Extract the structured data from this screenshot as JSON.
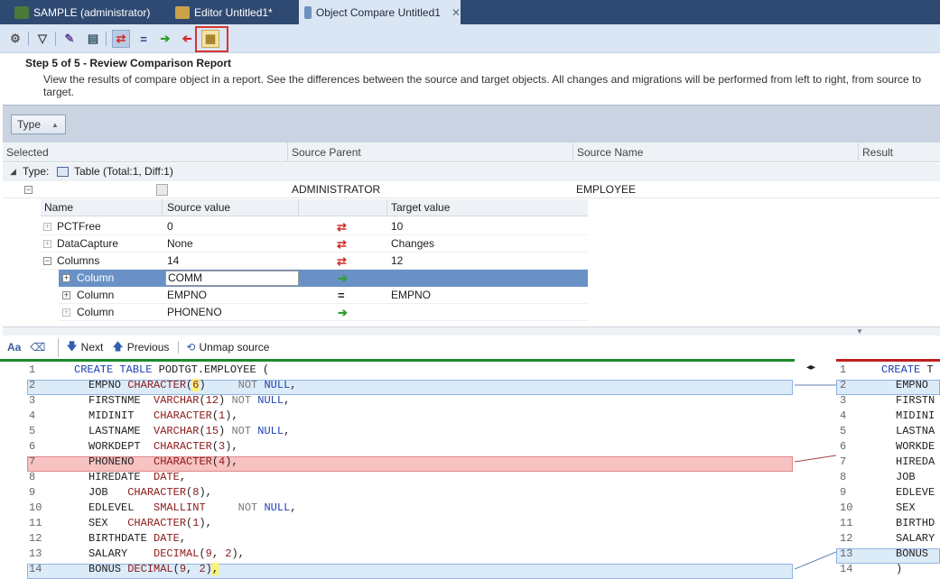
{
  "tabs": [
    {
      "label": "SAMPLE (administrator)"
    },
    {
      "label": "Editor Untitled1*"
    },
    {
      "label": "Object Compare Untitled1"
    }
  ],
  "step": {
    "title": "Step 5 of 5 - Review Comparison Report",
    "description": "View the results of compare object in a report. See the differences between the source and target objects. All changes and migrations will be performed from left to right, from source to target."
  },
  "type_filter": {
    "label": "Type"
  },
  "grid": {
    "headers": [
      "Selected",
      "Source Parent",
      "Source Name",
      "Result"
    ],
    "group_label": "Type:",
    "group_value": "Table (Total:1, Diff:1)",
    "table_row": {
      "source_parent": "ADMINISTRATOR",
      "source_name": "EMPLOYEE"
    },
    "sub_headers": [
      "Name",
      "Source value",
      "Target value"
    ],
    "rows": [
      {
        "name": "PCTFree",
        "source": "0",
        "target": "10",
        "result": "diff"
      },
      {
        "name": "DataCapture",
        "source": "None",
        "target": "Changes",
        "result": "diff"
      },
      {
        "name": "Columns",
        "source": "14",
        "target": "12",
        "result": "diff"
      },
      {
        "name": "Column",
        "source": "COMM",
        "target": "",
        "result": "add"
      },
      {
        "name": "Column",
        "source": "EMPNO",
        "target": "EMPNO",
        "result": "equal"
      },
      {
        "name": "Column",
        "source": "PHONENO",
        "target": "",
        "result": "add"
      }
    ]
  },
  "nav": {
    "next": "Next",
    "previous": "Previous",
    "unmap": "Unmap source"
  },
  "code_left": [
    {
      "n": "1",
      "text": "CREATE TABLE PODTGT.EMPLOYEE ("
    },
    {
      "n": "2",
      "text": "EMPNO CHARACTER(6)     NOT NULL,"
    },
    {
      "n": "3",
      "text": "FIRSTNME  VARCHAR(12) NOT NULL,"
    },
    {
      "n": "4",
      "text": "MIDINIT   CHARACTER(1),"
    },
    {
      "n": "5",
      "text": "LASTNAME  VARCHAR(15) NOT NULL,"
    },
    {
      "n": "6",
      "text": "WORKDEPT  CHARACTER(3),"
    },
    {
      "n": "7",
      "text": "PHONENO   CHARACTER(4),"
    },
    {
      "n": "8",
      "text": "HIREDATE  DATE,"
    },
    {
      "n": "9",
      "text": "JOB   CHARACTER(8),"
    },
    {
      "n": "10",
      "text": "EDLEVEL   SMALLINT     NOT NULL,"
    },
    {
      "n": "11",
      "text": "SEX   CHARACTER(1),"
    },
    {
      "n": "12",
      "text": "BIRTHDATE DATE,"
    },
    {
      "n": "13",
      "text": "SALARY    DECIMAL(9, 2),"
    },
    {
      "n": "14",
      "text": "BONUS DECIMAL(9, 2),"
    }
  ],
  "code_right": [
    {
      "n": "1",
      "text": "CREATE T"
    },
    {
      "n": "2",
      "text": "EMPNO"
    },
    {
      "n": "3",
      "text": "FIRSTN"
    },
    {
      "n": "4",
      "text": "MIDINI"
    },
    {
      "n": "5",
      "text": "LASTNA"
    },
    {
      "n": "6",
      "text": "WORKDE"
    },
    {
      "n": "7",
      "text": "HIREDA"
    },
    {
      "n": "8",
      "text": "JOB"
    },
    {
      "n": "9",
      "text": "EDLEVE"
    },
    {
      "n": "10",
      "text": "SEX"
    },
    {
      "n": "11",
      "text": "BIRTHD"
    },
    {
      "n": "12",
      "text": "SALARY"
    },
    {
      "n": "13",
      "text": "BONUS"
    },
    {
      "n": "14",
      "text": ")"
    }
  ],
  "colors": {
    "diff_arrow": "#d42a2a",
    "add_arrow": "#2e9e2e",
    "selection": "#6a91c6",
    "changed_line": "#f7c2c2",
    "modified_line": "#dcebf8"
  }
}
